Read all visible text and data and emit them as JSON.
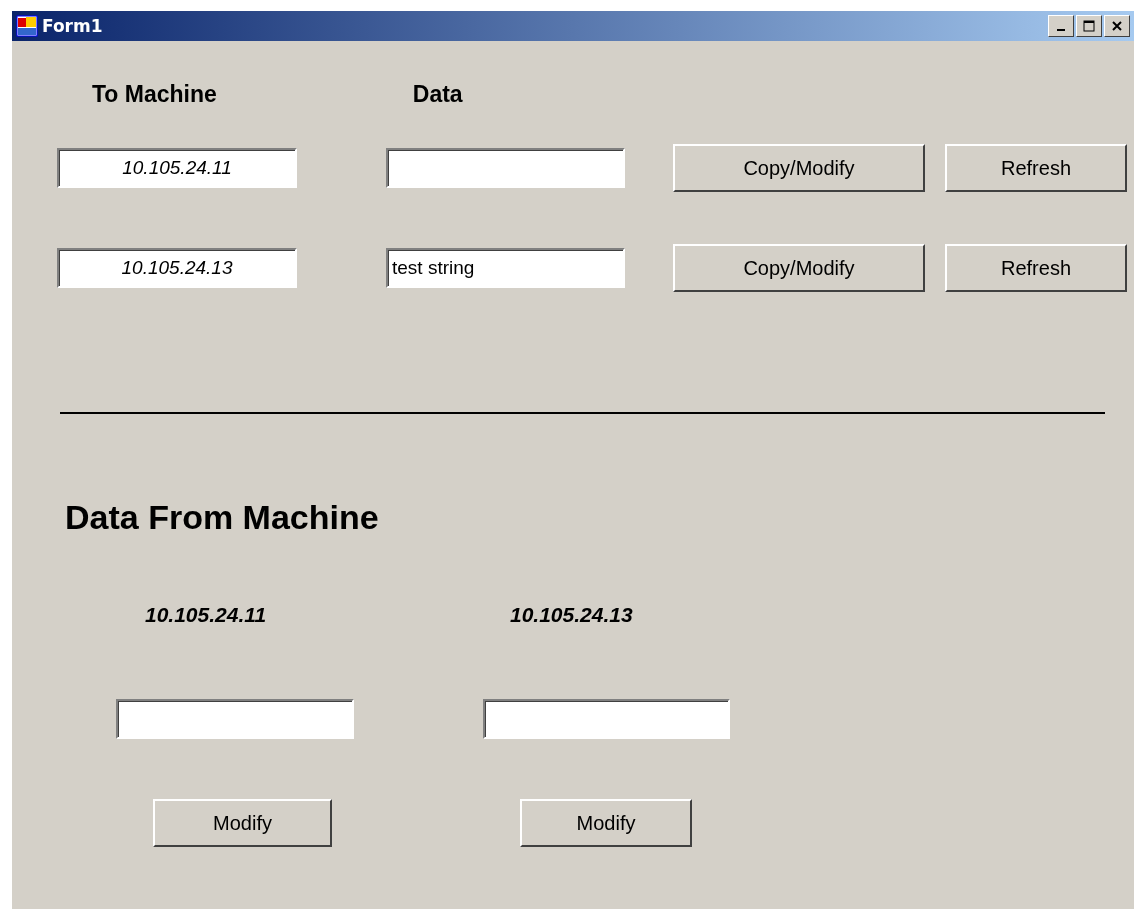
{
  "window": {
    "title": "Form1"
  },
  "to_machine": {
    "headers": [
      "To Machine",
      "Data"
    ],
    "rows": [
      {
        "machine": "10.105.24.11",
        "buttons": [
          "Copy/Modify",
          "Refresh"
        ]
      },
      {
        "machine": "10.105.24.13",
        "data": "test string",
        "buttons": [
          "Copy/Modify",
          "Refresh"
        ]
      }
    ]
  },
  "from_machine": {
    "title": "Data From Machine",
    "machines": [
      {
        "label": "10.105.24.11",
        "button": "Modify"
      },
      {
        "label": "10.105.24.13",
        "button": "Modify"
      }
    ]
  }
}
